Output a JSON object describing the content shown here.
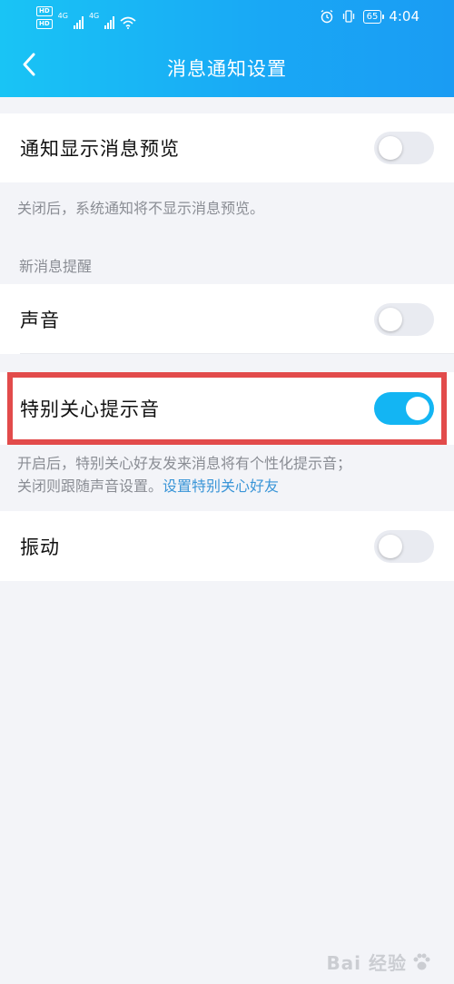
{
  "status_bar": {
    "hd_labels": [
      "HD",
      "HD"
    ],
    "net1": "4G",
    "net2": "4G",
    "battery": "65",
    "time": "4:04"
  },
  "nav": {
    "title": "消息通知设置",
    "back_icon": "chevron-left-icon"
  },
  "settings": {
    "preview": {
      "label": "通知显示消息预览",
      "enabled": false
    },
    "preview_hint": "关闭后，系统通知将不显示消息预览。",
    "new_msg_section": "新消息提醒",
    "sound": {
      "label": "声音",
      "enabled": false
    },
    "special_tone": {
      "label": "特别关心提示音",
      "enabled": true
    },
    "special_hint_line1": "开启后，特别关心好友发来消息将有个性化提示音；",
    "special_hint_line2": "关闭则跟随声音设置。",
    "special_hint_link": "设置特别关心好友",
    "vibrate": {
      "label": "振动",
      "enabled": false
    }
  },
  "watermark": {
    "text": "Bai 经验"
  },
  "colors": {
    "header_start": "#19c4f5",
    "header_end": "#1a9cf3",
    "toggle_on": "#13b5f3",
    "toggle_off": "#e9ebf1",
    "highlight": "#e24b4b",
    "link": "#3a95d7"
  }
}
